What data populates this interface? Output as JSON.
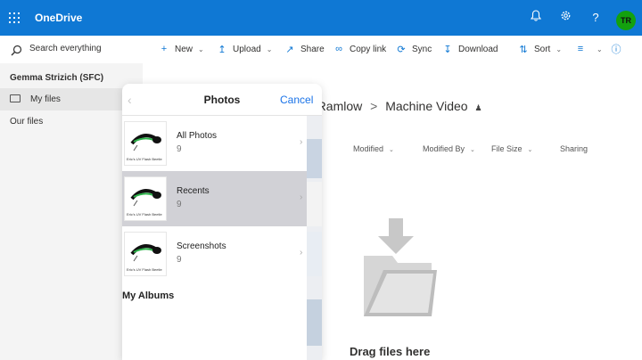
{
  "app": {
    "name": "OneDrive",
    "user_initials": "TR"
  },
  "colors": {
    "brand": "#0f78d4",
    "avatar": "#13a10e",
    "picker_accent": "#1a73e8",
    "selected_row": "#d1d1d6"
  },
  "topbar": {
    "icons": [
      "bell-icon",
      "gear-icon",
      "help-icon"
    ]
  },
  "search": {
    "placeholder": "Search everything"
  },
  "toolbar": {
    "new_label": "New",
    "upload_label": "Upload",
    "share_label": "Share",
    "copy_link_label": "Copy link",
    "sync_label": "Sync",
    "download_label": "Download",
    "sort_label": "Sort"
  },
  "nav": {
    "account": "Gemma Strizich (SFC)",
    "items": [
      {
        "label": "My files",
        "selected": true
      },
      {
        "label": "Our files",
        "selected": false
      }
    ]
  },
  "main": {
    "breadcrumb_parent": "r. Ramlow",
    "breadcrumb_separator": ">",
    "breadcrumb_current": "Machine Video",
    "columns": [
      "Modified",
      "Modified By",
      "File Size",
      "Sharing"
    ],
    "empty_message": "Drag files here"
  },
  "picker": {
    "title": "Photos",
    "cancel_label": "Cancel",
    "thumb_caption": "Eric's UV Flash Beetle",
    "albums": [
      {
        "name": "All Photos",
        "count": "9",
        "selected": false
      },
      {
        "name": "Recents",
        "count": "9",
        "selected": true
      },
      {
        "name": "Screenshots",
        "count": "9",
        "selected": false
      }
    ],
    "my_albums_heading": "My Albums"
  }
}
